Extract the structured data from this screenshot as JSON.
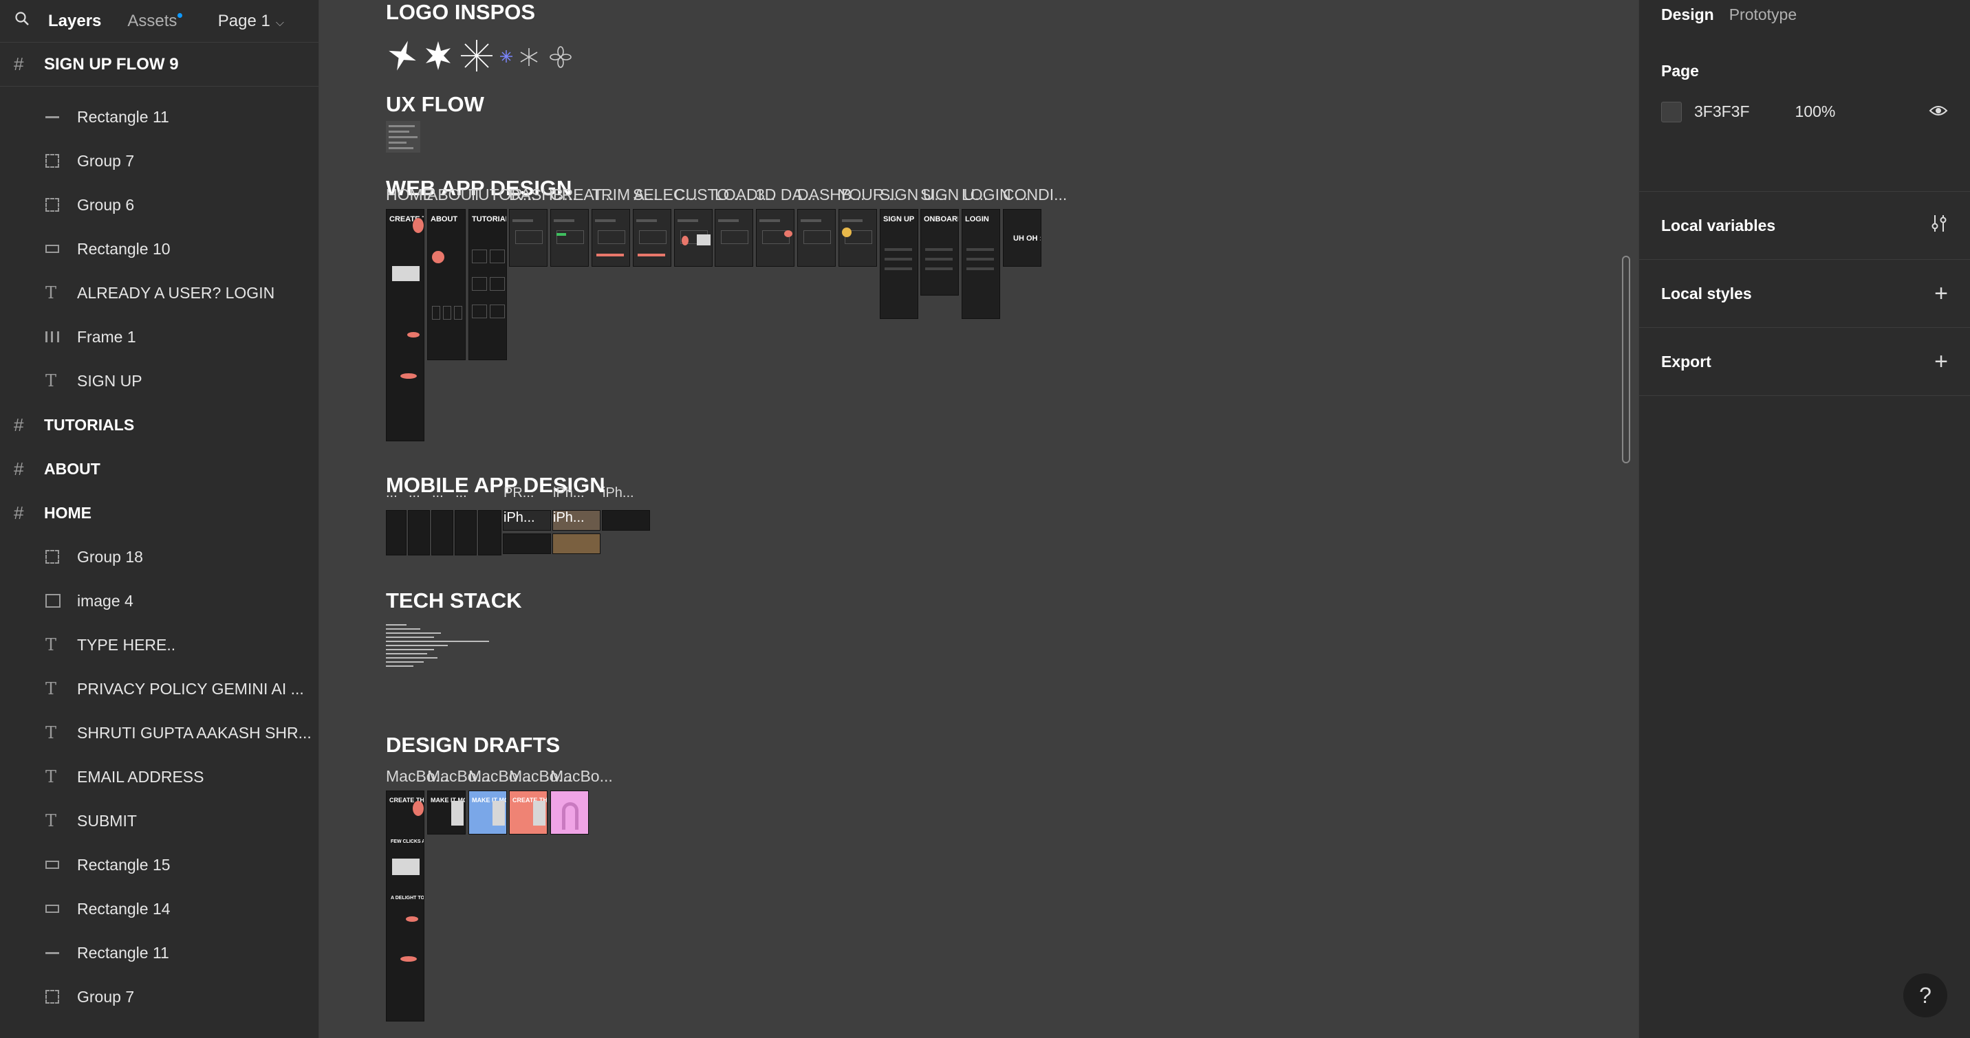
{
  "left_panel": {
    "tabs": {
      "layers": "Layers",
      "assets": "Assets"
    },
    "page_select": "Page 1",
    "current_frame": "SIGN UP FLOW 9",
    "layers": [
      {
        "label": "Rectangle 11",
        "icon": "line-icon",
        "level": "child"
      },
      {
        "label": "Group 7",
        "icon": "group-icon",
        "level": "child"
      },
      {
        "label": "Group 6",
        "icon": "group-icon",
        "level": "child"
      },
      {
        "label": "Rectangle 10",
        "icon": "rectangle-icon",
        "level": "child"
      },
      {
        "label": "ALREADY A USER? LOGIN",
        "icon": "text-icon",
        "level": "child"
      },
      {
        "label": "Frame 1",
        "icon": "frame-columns-icon",
        "level": "child"
      },
      {
        "label": "SIGN UP",
        "icon": "text-icon",
        "level": "child"
      },
      {
        "label": "TUTORIALS",
        "icon": "hash-icon",
        "level": "top"
      },
      {
        "label": "ABOUT",
        "icon": "hash-icon",
        "level": "top"
      },
      {
        "label": "HOME",
        "icon": "hash-icon",
        "level": "top"
      },
      {
        "label": "Group 18",
        "icon": "group-icon",
        "level": "child"
      },
      {
        "label": "image 4",
        "icon": "image-icon",
        "level": "child"
      },
      {
        "label": "TYPE HERE..",
        "icon": "text-icon",
        "level": "child"
      },
      {
        "label": "PRIVACY POLICY GEMINI AI ...",
        "icon": "text-icon",
        "level": "child"
      },
      {
        "label": "SHRUTI GUPTA AAKASH SHR...",
        "icon": "text-icon",
        "level": "child"
      },
      {
        "label": "EMAIL ADDRESS",
        "icon": "text-icon",
        "level": "child"
      },
      {
        "label": "SUBMIT",
        "icon": "text-icon",
        "level": "child"
      },
      {
        "label": "Rectangle 15",
        "icon": "rectangle-icon",
        "level": "child"
      },
      {
        "label": "Rectangle 14",
        "icon": "rectangle-icon",
        "level": "child"
      },
      {
        "label": "Rectangle 11",
        "icon": "line-icon",
        "level": "child"
      },
      {
        "label": "Group 7",
        "icon": "group-icon",
        "level": "child"
      }
    ]
  },
  "right_panel": {
    "tabs": {
      "design": "Design",
      "prototype": "Prototype"
    },
    "page_title": "Page",
    "page_color": "3F3F3F",
    "page_opacity": "100%",
    "local_variables": "Local variables",
    "local_styles": "Local styles",
    "export": "Export",
    "help": "?"
  },
  "canvas": {
    "background": "#3f3f3f",
    "sections": {
      "logo_inspos": "LOGO INSPOS",
      "ux_flow": "UX FLOW",
      "web_app_design": "WEB APP DESIGN",
      "mobile_app_design": "MOBILE APP DESIGN",
      "tech_stack": "TECH STACK",
      "design_drafts": "DESIGN DRAFTS"
    },
    "web_frames": [
      {
        "label": "HOME",
        "title": "CREATE THE BEAT."
      },
      {
        "label": "ABOUT",
        "title": "ABOUT"
      },
      {
        "label": "TUTOR...",
        "title": "TUTORIALS"
      },
      {
        "label": "DASHB...",
        "title": ""
      },
      {
        "label": "CREAT...",
        "title": ""
      },
      {
        "label": "TRIM A...",
        "title": ""
      },
      {
        "label": "SELEC...",
        "title": ""
      },
      {
        "label": "CUSTO...",
        "title": ""
      },
      {
        "label": "LOADI...",
        "title": ""
      },
      {
        "label": "3D DA...",
        "title": ""
      },
      {
        "label": "DASHB...",
        "title": ""
      },
      {
        "label": "YOUR ...",
        "title": ""
      },
      {
        "label": "SIGN U...",
        "title": "SIGN UP"
      },
      {
        "label": "SIGN U...",
        "title": "ONBOARDING"
      },
      {
        "label": "LOGIN ...",
        "title": "LOGIN"
      },
      {
        "label": "CONDI...",
        "title": "UH OH :("
      }
    ],
    "mobile_labels": [
      "...",
      "...",
      "...",
      "...",
      "PR...",
      "iPh...",
      "iPh..."
    ],
    "mobile_inner_labels": [
      "iPh...",
      "iPh..."
    ],
    "draft_frames": [
      {
        "label": "MacBo...",
        "title": "CREATE THE BEAT.",
        "bg": "#1b1b1b"
      },
      {
        "label": "MacBo...",
        "title": "MAKE IT MOVE.",
        "bg": "#1b1b1b"
      },
      {
        "label": "MacBo...",
        "title": "MAKE IT MOVE.",
        "bg": "#7aa7e8"
      },
      {
        "label": "MacBo...",
        "title": "CREATE THE BEAT.",
        "bg": "#ef8374"
      },
      {
        "label": "MacBo...",
        "title": "",
        "bg": "#f0a4e6"
      }
    ],
    "home_texts": {
      "few_clicks": "FEW CLICKS AND IT'S DONE",
      "a_delight": "A DELIGHT TO EYES"
    }
  }
}
